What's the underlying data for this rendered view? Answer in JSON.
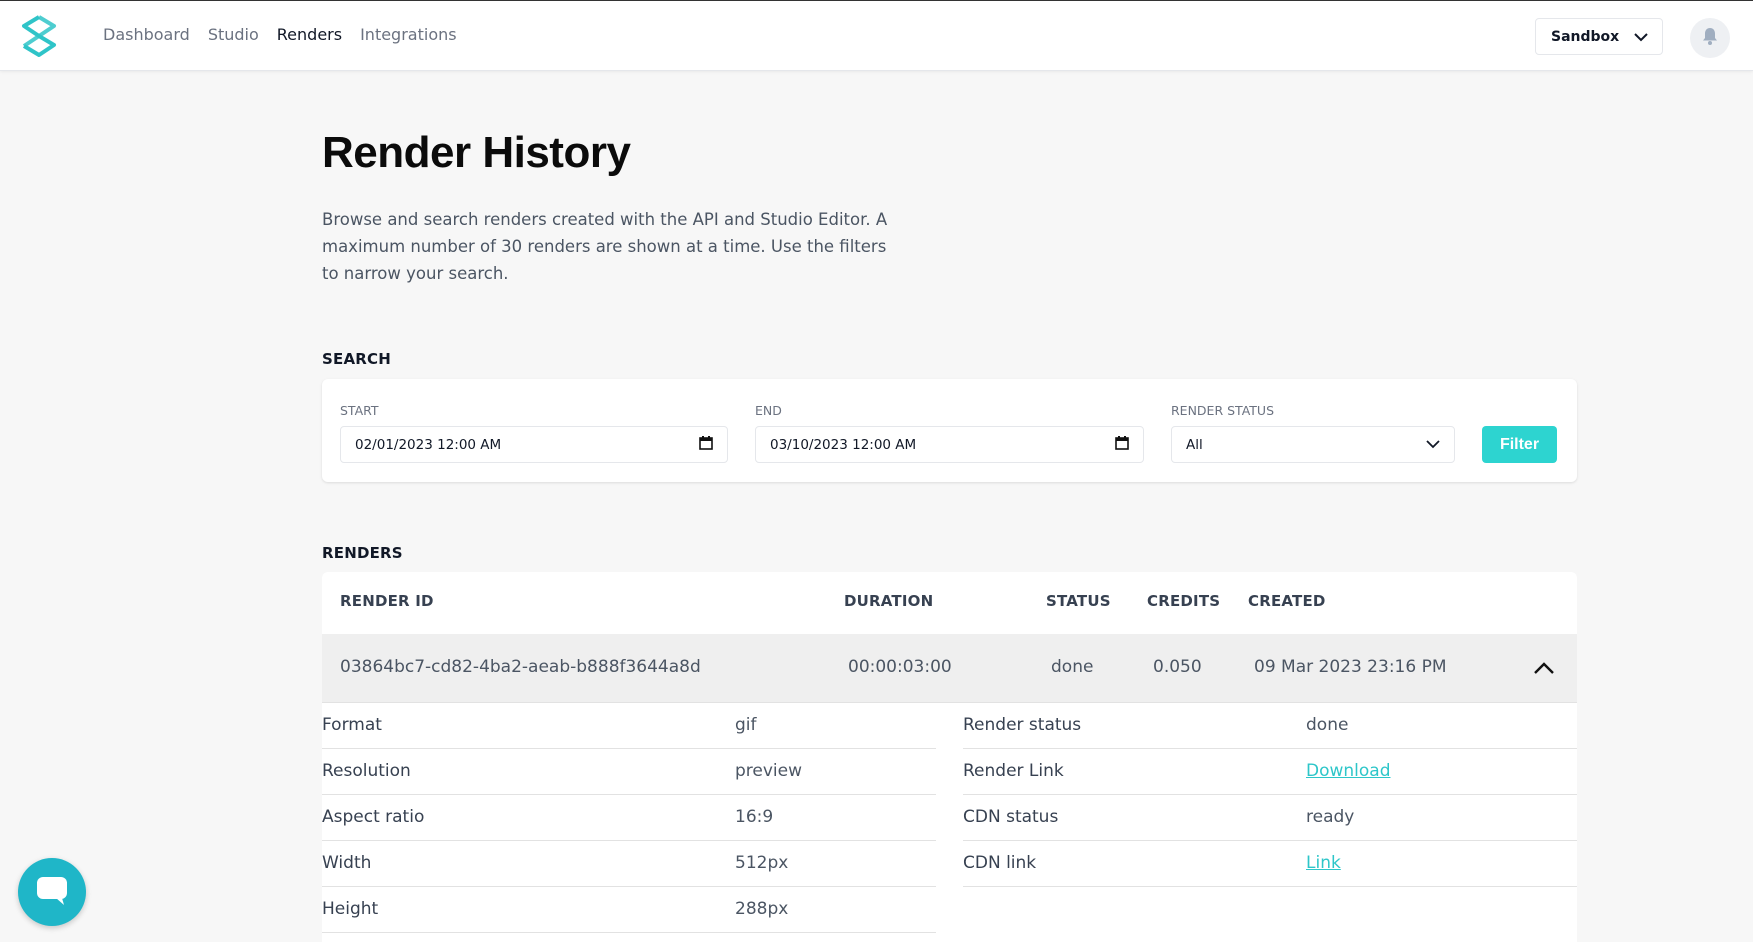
{
  "nav": {
    "items": [
      {
        "label": "Dashboard",
        "active": false
      },
      {
        "label": "Studio",
        "active": false
      },
      {
        "label": "Renders",
        "active": true
      },
      {
        "label": "Integrations",
        "active": false
      }
    ],
    "environment": "Sandbox"
  },
  "page": {
    "title": "Render History",
    "intro": "Browse and search renders created with the API and Studio Editor. A maximum number of 30 renders are shown at a time. Use the filters to narrow your search."
  },
  "search": {
    "section_label": "SEARCH",
    "start_label": "START",
    "start_value": "02/01/2023 12:00  AM",
    "end_label": "END",
    "end_value": "03/10/2023 12:00  AM",
    "status_label": "RENDER STATUS",
    "status_value": "All",
    "filter_button": "Filter"
  },
  "renders": {
    "section_label": "RENDERS",
    "columns": {
      "render_id": "RENDER ID",
      "duration": "DURATION",
      "status": "STATUS",
      "credits": "CREDITS",
      "created": "CREATED"
    },
    "rows": [
      {
        "render_id": "03864bc7-cd82-4ba2-aeab-b888f3644a8d",
        "duration": "00:00:03:00",
        "status": "done",
        "credits": "0.050",
        "created": "09 Mar 2023 23:16 PM",
        "details": {
          "left": [
            {
              "key": "Format",
              "value": "gif"
            },
            {
              "key": "Resolution",
              "value": "preview"
            },
            {
              "key": "Aspect ratio",
              "value": "16:9"
            },
            {
              "key": "Width",
              "value": "512px"
            },
            {
              "key": "Height",
              "value": "288px"
            }
          ],
          "right": [
            {
              "key": "Render status",
              "value": "done"
            },
            {
              "key": "Render Link",
              "value": "Download"
            },
            {
              "key": "CDN status",
              "value": "ready"
            },
            {
              "key": "CDN link",
              "value": "Link"
            }
          ]
        }
      }
    ]
  },
  "colors": {
    "accent": "#2dd4d0",
    "link": "#2dc6c9",
    "chat": "#1fb6c8"
  },
  "icons": [
    "logo-icon",
    "chevron-down-icon",
    "bell-icon",
    "calendar-icon",
    "chevron-up-icon",
    "chat-icon"
  ]
}
